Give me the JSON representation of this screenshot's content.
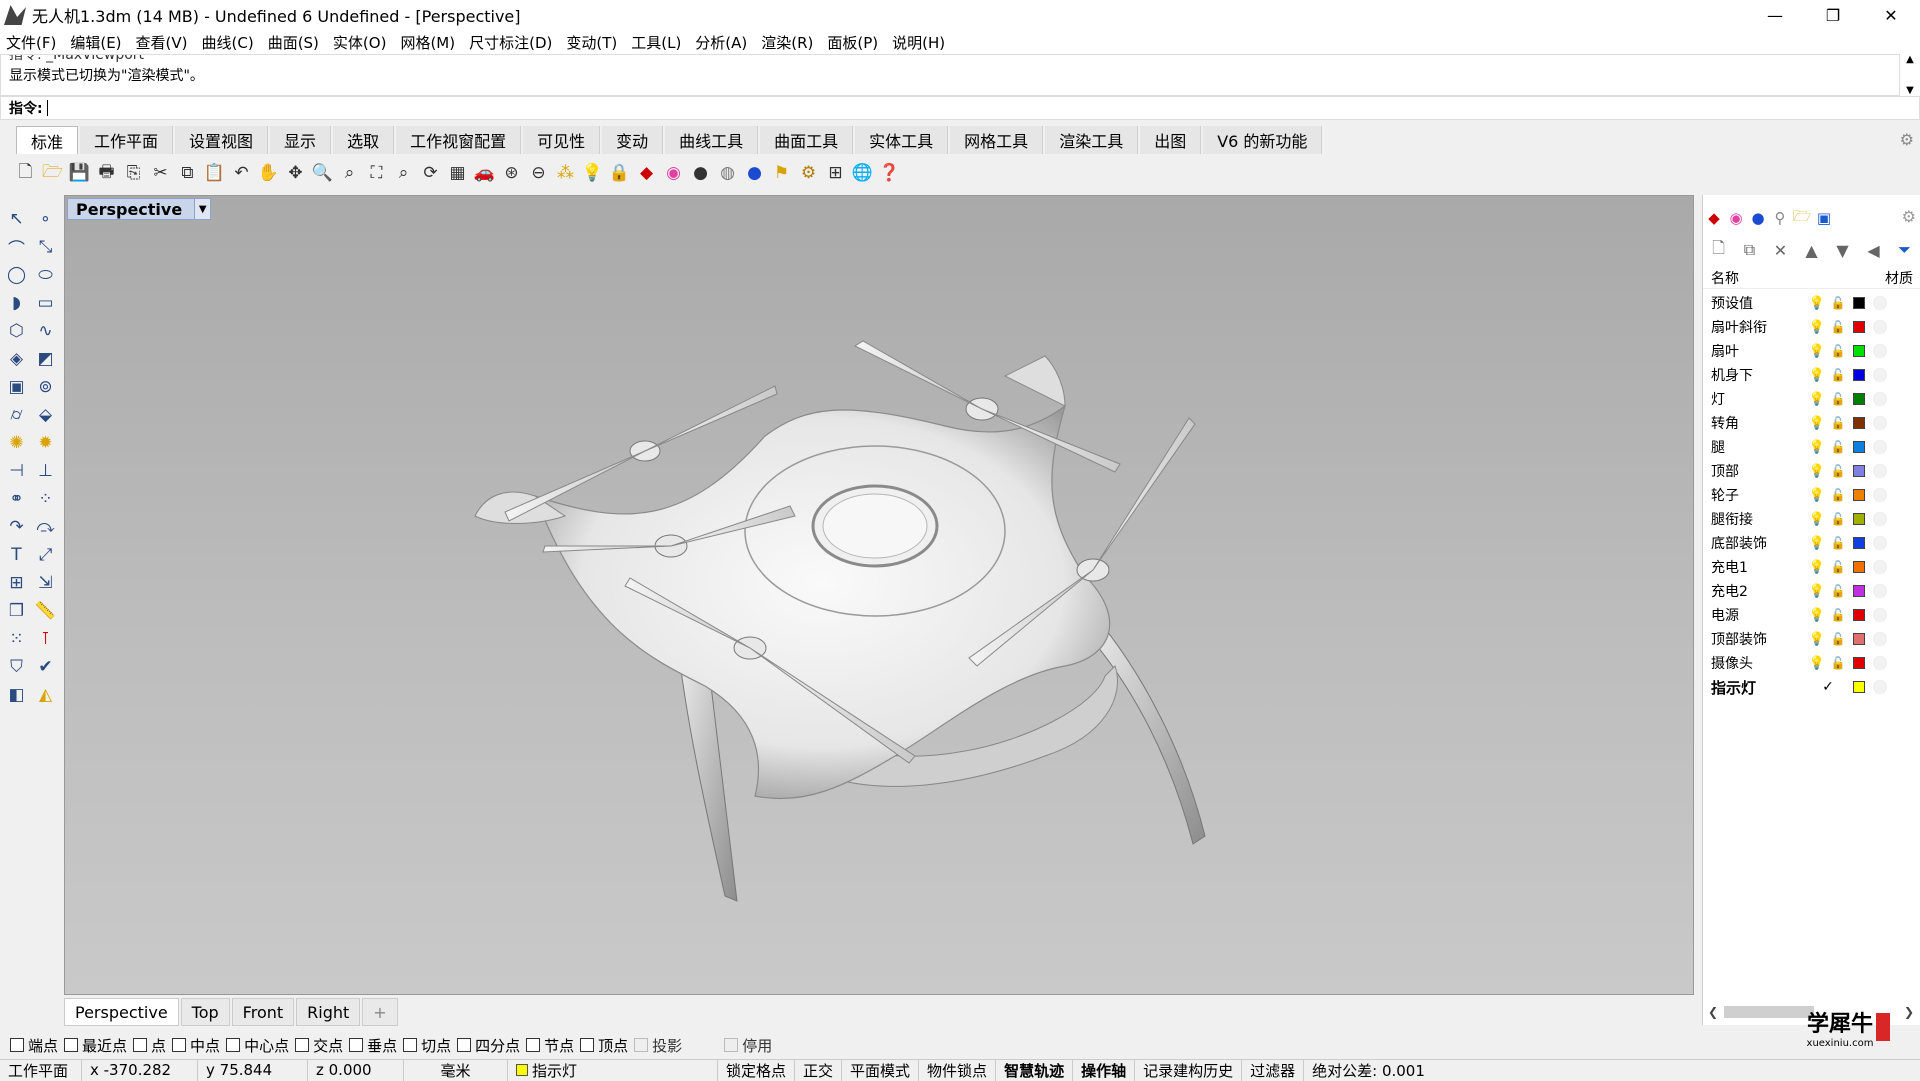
{
  "window": {
    "title": "无人机1.3dm (14 MB) - Undefined 6 Undefined - [Perspective]",
    "controls": [
      "—",
      "❐",
      "✕"
    ]
  },
  "menu": [
    "文件(F)",
    "编辑(E)",
    "查看(V)",
    "曲线(C)",
    "曲面(S)",
    "实体(O)",
    "网格(M)",
    "尺寸标注(D)",
    "变动(T)",
    "工具(L)",
    "分析(A)",
    "渲染(R)",
    "面板(P)",
    "说明(H)"
  ],
  "command": {
    "history_line1": "指令: _MaxViewport",
    "history_line2": "显示模式已切换为\"渲染模式\"。",
    "prompt": "指令:",
    "value": ""
  },
  "toolbar_tabs": [
    "标准",
    "工作平面",
    "设置视图",
    "显示",
    "选取",
    "工作视窗配置",
    "可见性",
    "变动",
    "曲线工具",
    "曲面工具",
    "实体工具",
    "网格工具",
    "渲染工具",
    "出图",
    "V6 的新功能"
  ],
  "active_tab_index": 0,
  "viewport": {
    "label": "Perspective",
    "tabs": [
      "Perspective",
      "Top",
      "Front",
      "Right"
    ],
    "add_tab": "+",
    "active_tab_index": 0
  },
  "snaps": [
    {
      "label": "端点",
      "checked": false,
      "disabled": false
    },
    {
      "label": "最近点",
      "checked": false,
      "disabled": false
    },
    {
      "label": "点",
      "checked": false,
      "disabled": false
    },
    {
      "label": "中点",
      "checked": false,
      "disabled": false
    },
    {
      "label": "中心点",
      "checked": false,
      "disabled": false
    },
    {
      "label": "交点",
      "checked": false,
      "disabled": false
    },
    {
      "label": "垂点",
      "checked": false,
      "disabled": false
    },
    {
      "label": "切点",
      "checked": false,
      "disabled": false
    },
    {
      "label": "四分点",
      "checked": false,
      "disabled": false
    },
    {
      "label": "节点",
      "checked": false,
      "disabled": false
    },
    {
      "label": "顶点",
      "checked": false,
      "disabled": false
    },
    {
      "label": "投影",
      "checked": false,
      "disabled": true
    },
    {
      "label": "停用",
      "checked": false,
      "disabled": true
    }
  ],
  "status": {
    "plane": "工作平面",
    "x": "x -370.282",
    "y": "y 75.844",
    "z": "z 0.000",
    "unit": "毫米",
    "layer": "指示灯",
    "layer_color": "#ffff00",
    "grid_snap": "锁定格点",
    "ortho": "正交",
    "planar": "平面模式",
    "osnap": "物件锁点",
    "smarttrack": "智慧轨迹",
    "gumball": "操作轴",
    "history": "记录建构历史",
    "filter": "过滤器",
    "tolerance": "绝对公差: 0.001"
  },
  "layers_panel": {
    "col_name": "名称",
    "col_material": "材质",
    "layers": [
      {
        "name": "预设值",
        "color": "#000000",
        "current": false
      },
      {
        "name": "扇叶斜衔",
        "color": "#e00000",
        "current": false
      },
      {
        "name": "扇叶",
        "color": "#00e000",
        "current": false
      },
      {
        "name": "机身下",
        "color": "#0000e0",
        "current": false
      },
      {
        "name": "灯",
        "color": "#008000",
        "current": false
      },
      {
        "name": "转角",
        "color": "#803000",
        "current": false
      },
      {
        "name": "腿",
        "color": "#1080e0",
        "current": false
      },
      {
        "name": "顶部",
        "color": "#8080e0",
        "current": false
      },
      {
        "name": "轮子",
        "color": "#f08000",
        "current": false
      },
      {
        "name": "腿衔接",
        "color": "#a0b000",
        "current": false
      },
      {
        "name": "底部装饰",
        "color": "#1040e0",
        "current": false
      },
      {
        "name": "充电1",
        "color": "#f07000",
        "current": false
      },
      {
        "name": "充电2",
        "color": "#c030e0",
        "current": false
      },
      {
        "name": "电源",
        "color": "#e00000",
        "current": false
      },
      {
        "name": "顶部装饰",
        "color": "#e07070",
        "current": false
      },
      {
        "name": "摄像头",
        "color": "#e00000",
        "current": false
      },
      {
        "name": "指示灯",
        "color": "#ffff00",
        "current": true,
        "check": "✓"
      }
    ]
  },
  "logo": {
    "main": "学犀牛",
    "sub": "xuexiniu.com"
  }
}
